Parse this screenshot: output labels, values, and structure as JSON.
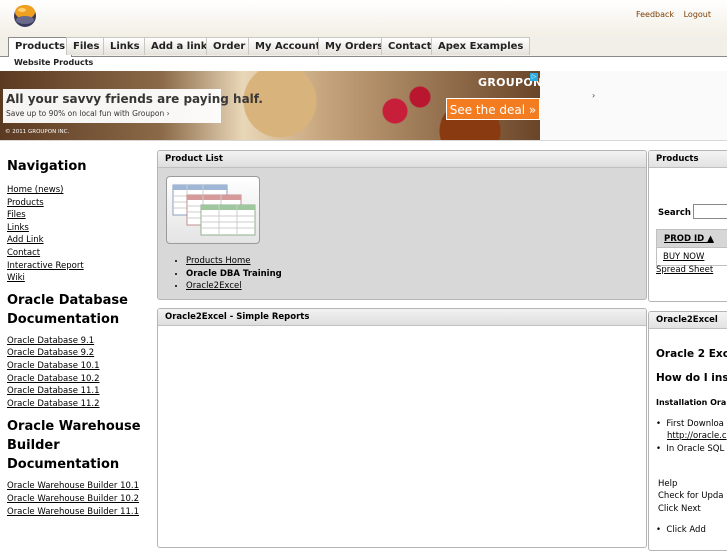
{
  "header": {
    "logo_icon": "sphere-logo-icon",
    "links": [
      "Feedback",
      "Logout"
    ]
  },
  "tabs": [
    "Products",
    "Files",
    "Links",
    "Add a link",
    "Order",
    "My Account",
    "My Orders",
    "Contact",
    "Apex Examples"
  ],
  "active_tab": "Products",
  "subnav": "Website Products",
  "ad": {
    "headline": "All your savvy friends are paying half.",
    "subline": "Save up to 90% on local fun with Groupon ›",
    "copyright": "© 2011 GROUPON INC.",
    "brand": "GROUPON",
    "cta": "See the deal »",
    "arrow": "›"
  },
  "leftnav": {
    "nav_heading": "Navigation",
    "nav_links": [
      "Home (news)",
      "Products",
      "Files",
      "Links",
      "Add Link",
      "Contact",
      "Interactive Report",
      "Wiki"
    ],
    "db_heading_1": "Oracle Database",
    "db_heading_2": "Documentation",
    "db_links": [
      "Oracle Database 9.1",
      "Oracle Database 9.2",
      "Oracle Database 10.1",
      "Oracle Database 10.2",
      "Oracle Database 11.1",
      "Oracle Database 11.2"
    ],
    "owb_heading_1": "Oracle Warehouse",
    "owb_heading_2": "Builder Documentation",
    "owb_links": [
      "Oracle Warehouse Builder 10.1",
      "Oracle Warehouse Builder 10.2",
      "Oracle Warehouse Builder 11.1"
    ]
  },
  "product_list": {
    "title": "Product List",
    "items": [
      {
        "label": "Products Home",
        "link": true
      },
      {
        "label": "Oracle DBA Training",
        "link": false
      },
      {
        "label": "Oracle2Excel",
        "link": true
      }
    ]
  },
  "oracle2excel_panel": {
    "title": "Oracle2Excel - Simple Reports"
  },
  "products_panel": {
    "title": "Products",
    "search_label": "Search",
    "column_header": "PROD ID ▲",
    "row_value": "BUY NOW",
    "spreadsheet_link": "Spread Sheet"
  },
  "oracle2excel_side": {
    "title": "Oracle2Excel",
    "heading_1": "Oracle 2 Exc",
    "heading_2": "How do I inst",
    "install_heading": "Installation Ora",
    "bullet_1": "First Downloa",
    "bullet_1_link": "http://oracle.c",
    "bullet_2": "In Oracle SQL",
    "help_1": "Help",
    "help_2": "Check for Upda",
    "help_3": "Click Next",
    "bullet_3": "Click Add"
  }
}
